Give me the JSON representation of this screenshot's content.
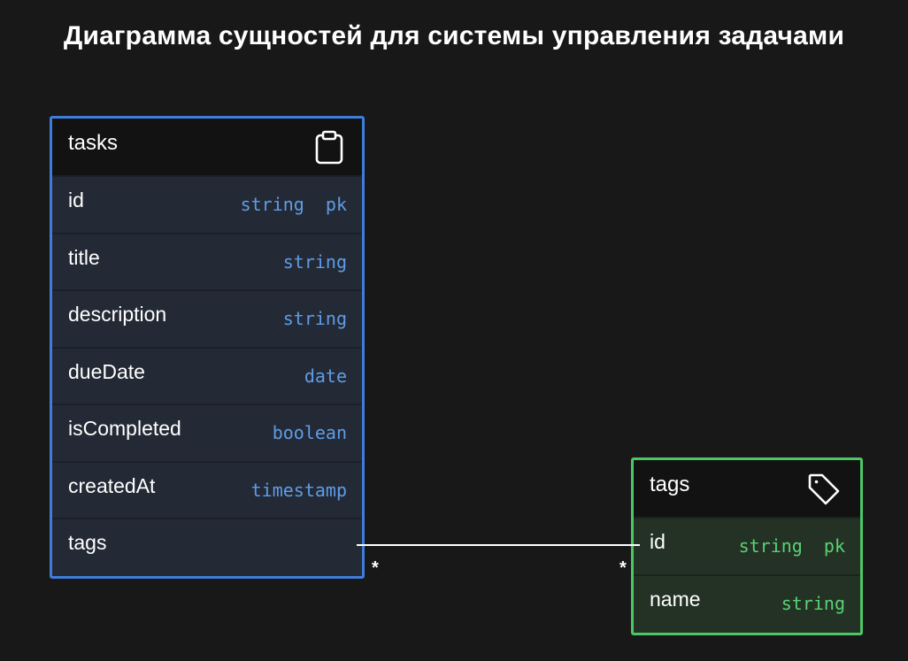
{
  "title": "Диаграмма сущностей для системы управления задачами",
  "entities": {
    "tasks": {
      "name": "tasks",
      "icon": "clipboard-icon",
      "border_color": "#3f7ddb",
      "fields": [
        {
          "name": "id",
          "type": "string  pk"
        },
        {
          "name": "title",
          "type": "string"
        },
        {
          "name": "description",
          "type": "string"
        },
        {
          "name": "dueDate",
          "type": "date"
        },
        {
          "name": "isCompleted",
          "type": "boolean"
        },
        {
          "name": "createdAt",
          "type": "timestamp"
        },
        {
          "name": "tags",
          "type": ""
        }
      ]
    },
    "tags": {
      "name": "tags",
      "icon": "tag-icon",
      "border_color": "#4cc767",
      "fields": [
        {
          "name": "id",
          "type": "string  pk"
        },
        {
          "name": "name",
          "type": "string"
        }
      ]
    }
  },
  "relationship": {
    "from": "tasks.tags",
    "to": "tags.id",
    "from_cardinality": "*",
    "to_cardinality": "*"
  }
}
